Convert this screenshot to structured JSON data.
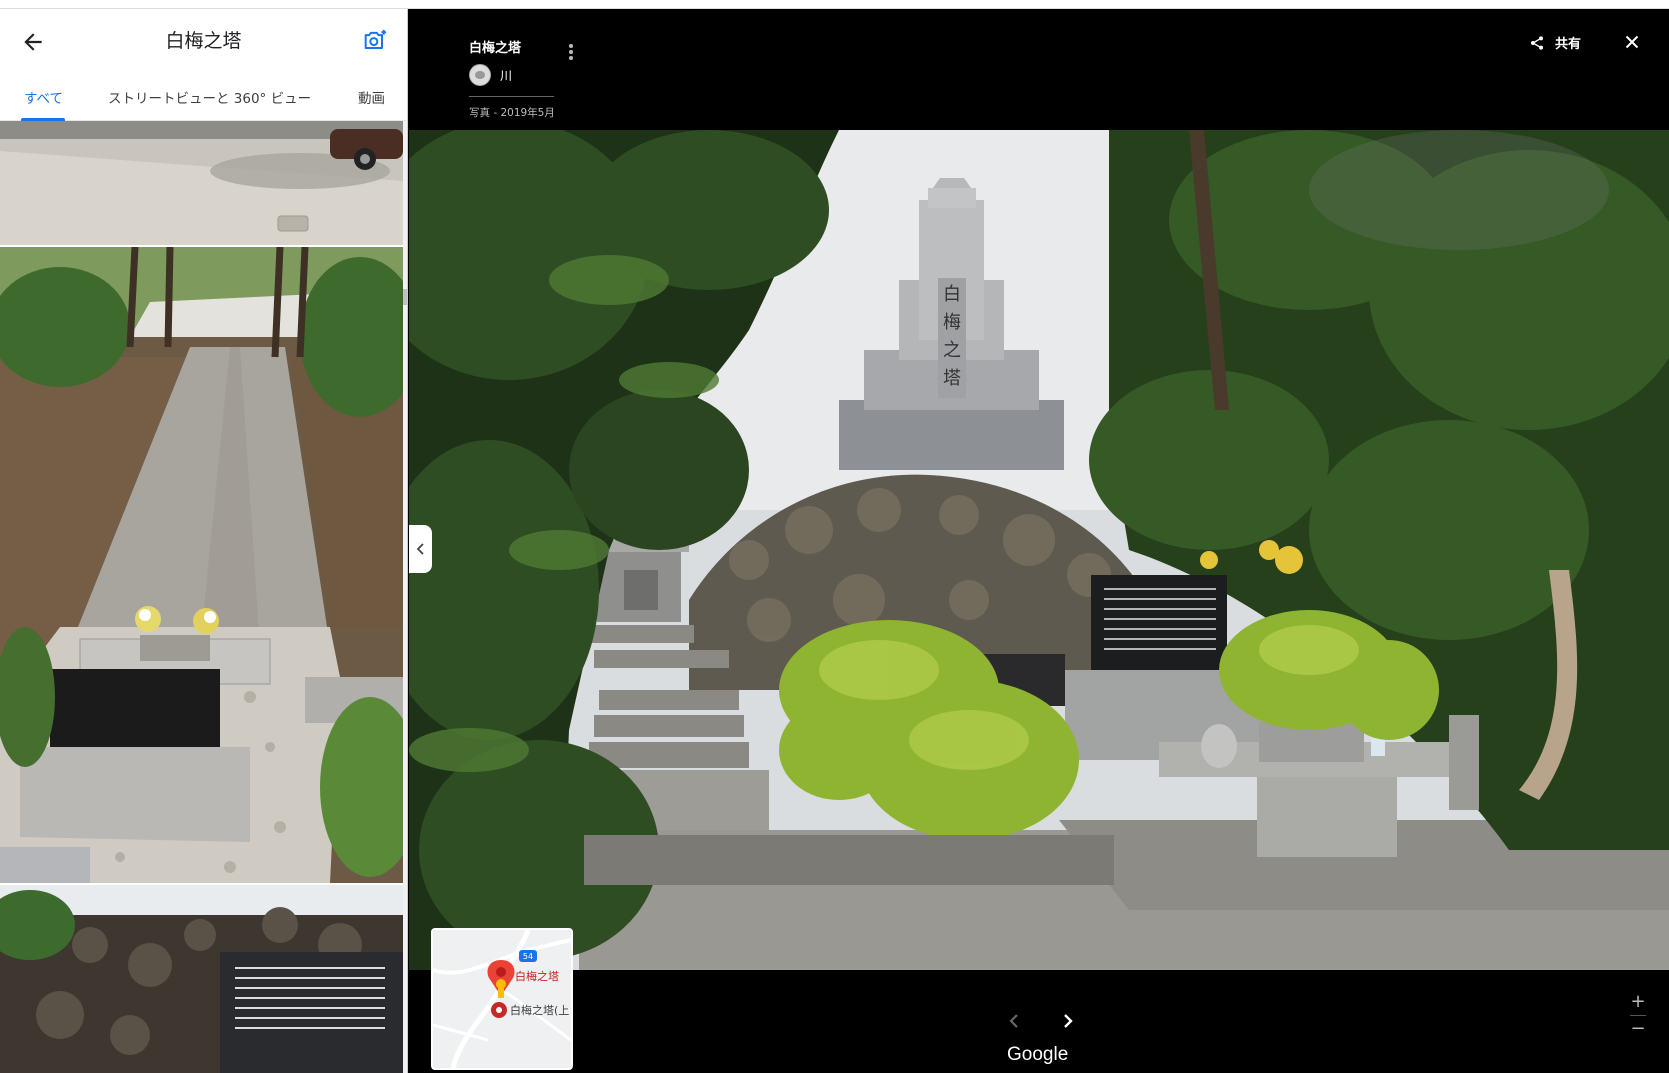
{
  "sidebar": {
    "title": "白梅之塔",
    "tabs": [
      {
        "label": "すべて"
      },
      {
        "label": "ストリートビューと 360° ビュー"
      },
      {
        "label": "動画"
      }
    ]
  },
  "viewer": {
    "place_name": "白梅之塔",
    "author": "川",
    "photo_date": "写真 - 2019年5月",
    "share_label": "共有",
    "brand": "Google"
  },
  "minimap": {
    "road_number": "54",
    "pin_label": "白梅之塔",
    "place_label": "白梅之塔(上"
  },
  "colors": {
    "accent": "#1a73e8",
    "pin": "#ea4335",
    "viewer_bg": "#000000"
  },
  "icons": [
    "back-arrow-icon",
    "add-photo-icon",
    "more-vert-icon",
    "share-icon",
    "close-icon",
    "chevron-left-icon",
    "chevron-right-icon",
    "zoom-in-icon",
    "zoom-out-icon"
  ]
}
